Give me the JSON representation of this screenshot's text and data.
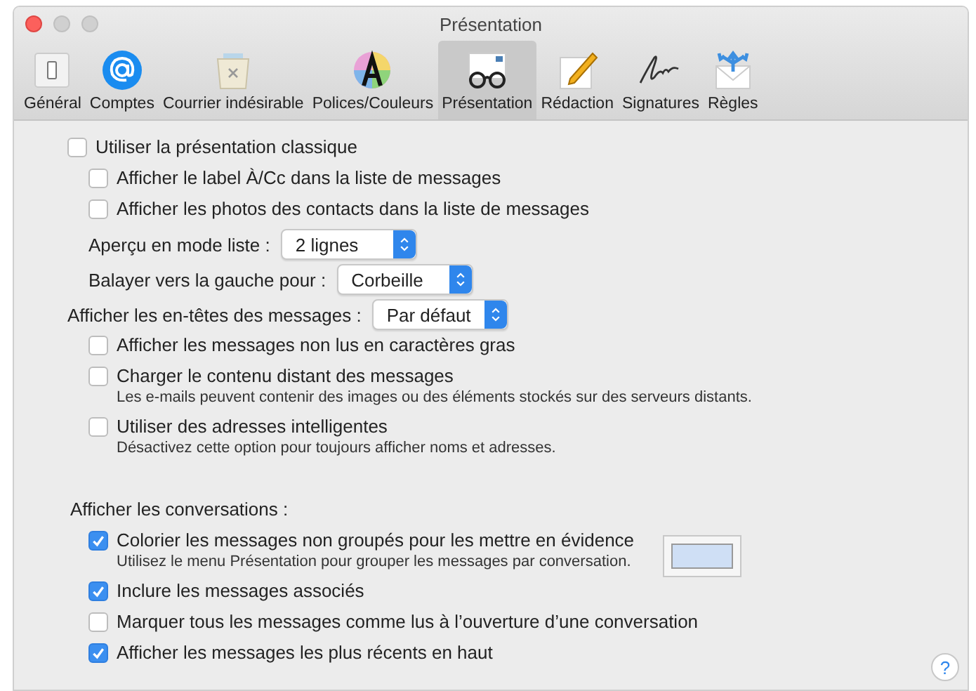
{
  "window": {
    "title": "Présentation"
  },
  "toolbar": [
    {
      "label": "Général",
      "selected": false
    },
    {
      "label": "Comptes",
      "selected": false
    },
    {
      "label": "Courrier indésirable",
      "selected": false
    },
    {
      "label": "Polices/Couleurs",
      "selected": false
    },
    {
      "label": "Présentation",
      "selected": true
    },
    {
      "label": "Rédaction",
      "selected": false
    },
    {
      "label": "Signatures",
      "selected": false
    },
    {
      "label": "Règles",
      "selected": false
    }
  ],
  "settings": [
    {
      "kind": "checkbox",
      "label": "Utiliser la présentation classique",
      "checked": false,
      "children": [
        {
          "kind": "checkbox",
          "label": "Afficher le label À/Cc dans la liste de messages",
          "checked": false
        },
        {
          "kind": "checkbox",
          "label": "Afficher les photos des contacts dans la liste de messages",
          "checked": false
        },
        {
          "kind": "popup",
          "label": "Aperçu en mode liste :",
          "value": "2 lignes"
        },
        {
          "kind": "popup",
          "label": "Balayer vers la gauche pour :",
          "value": "Corbeille"
        }
      ]
    },
    {
      "kind": "popup",
      "label": "Afficher les en-têtes des messages :",
      "value": "Par défaut",
      "children": [
        {
          "kind": "checkbox",
          "label": "Afficher les messages non lus en caractères gras",
          "checked": false
        },
        {
          "kind": "checkbox",
          "label": "Charger le contenu distant des messages",
          "checked": false,
          "note": "Les e-mails peuvent contenir des images ou des éléments stockés sur des serveurs distants."
        },
        {
          "kind": "checkbox",
          "label": "Utiliser des adresses intelligentes",
          "checked": false,
          "note": "Désactivez cette option pour toujours afficher noms et adresses."
        }
      ]
    },
    {
      "kind": "heading",
      "label": "Afficher les conversations :",
      "children": [
        {
          "kind": "checkbox",
          "label": "Colorier les messages non groupés pour les mettre en évidence",
          "checked": true,
          "note": "Utilisez le menu Présentation pour grouper les messages par conversation.",
          "color": "#cfdff5"
        },
        {
          "kind": "checkbox",
          "label": "Inclure les messages associés",
          "checked": true
        },
        {
          "kind": "checkbox",
          "label": "Marquer tous les messages comme lus à l’ouverture d’une conversation",
          "checked": false
        },
        {
          "kind": "checkbox",
          "label": "Afficher les messages les plus récents en haut",
          "checked": true
        }
      ]
    }
  ],
  "help": {
    "label": "?"
  }
}
